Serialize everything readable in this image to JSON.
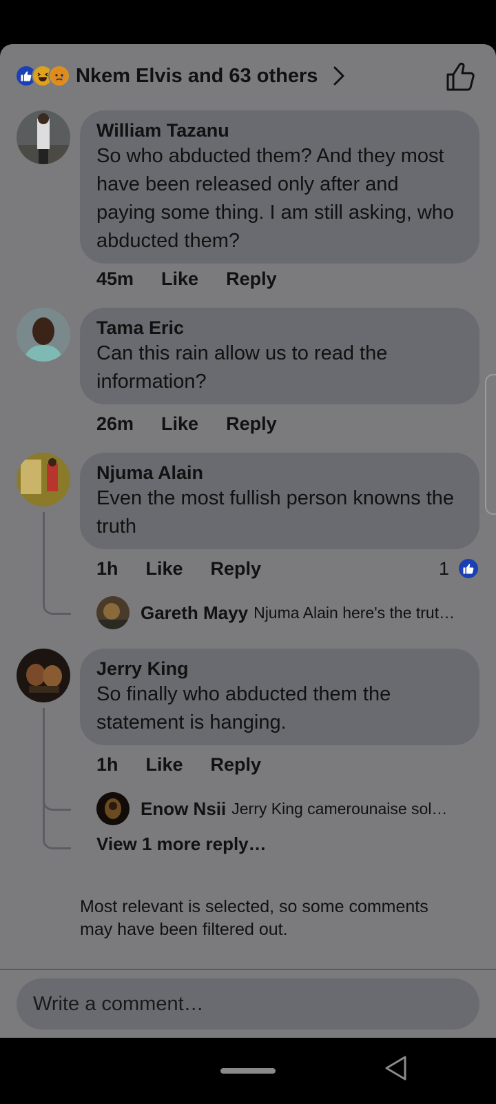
{
  "header": {
    "reactors": "Nkem Elvis and 63 others",
    "reactions": [
      "like-icon",
      "haha-icon",
      "sad-icon"
    ]
  },
  "comments": [
    {
      "author": "William Tazanu",
      "text": "So who abducted them? And  they most have been released only after and paying some thing. I am still asking, who abducted them?",
      "time": "45m",
      "like": "Like",
      "reply": "Reply"
    },
    {
      "author": "Tama Eric",
      "text": "Can this rain allow us to read the information?",
      "time": "26m",
      "like": "Like",
      "reply": "Reply"
    },
    {
      "author": "Njuma Alain",
      "text": "Even the most fullish person knowns the truth",
      "time": "1h",
      "like": "Like",
      "reply": "Reply",
      "like_count": "1",
      "replies": [
        {
          "author": "Gareth Mayy",
          "text": "Njuma Alain here's the trut…"
        }
      ]
    },
    {
      "author": "Jerry King",
      "text": "So finally  who abducted them the statement is  hanging.",
      "time": "1h",
      "like": "Like",
      "reply": "Reply",
      "replies": [
        {
          "author": "Enow Nsii",
          "text": "Jerry King  camerounaise sol…"
        }
      ],
      "view_more": "View 1 more reply…"
    }
  ],
  "filter_note": "Most relevant is selected, so some comments may have been filtered out.",
  "composer": {
    "placeholder": "Write a comment…"
  },
  "colors": {
    "sheet": "#7b7b7d",
    "bubble": "#6a6b70",
    "like_blue": "#1b3fb5"
  }
}
